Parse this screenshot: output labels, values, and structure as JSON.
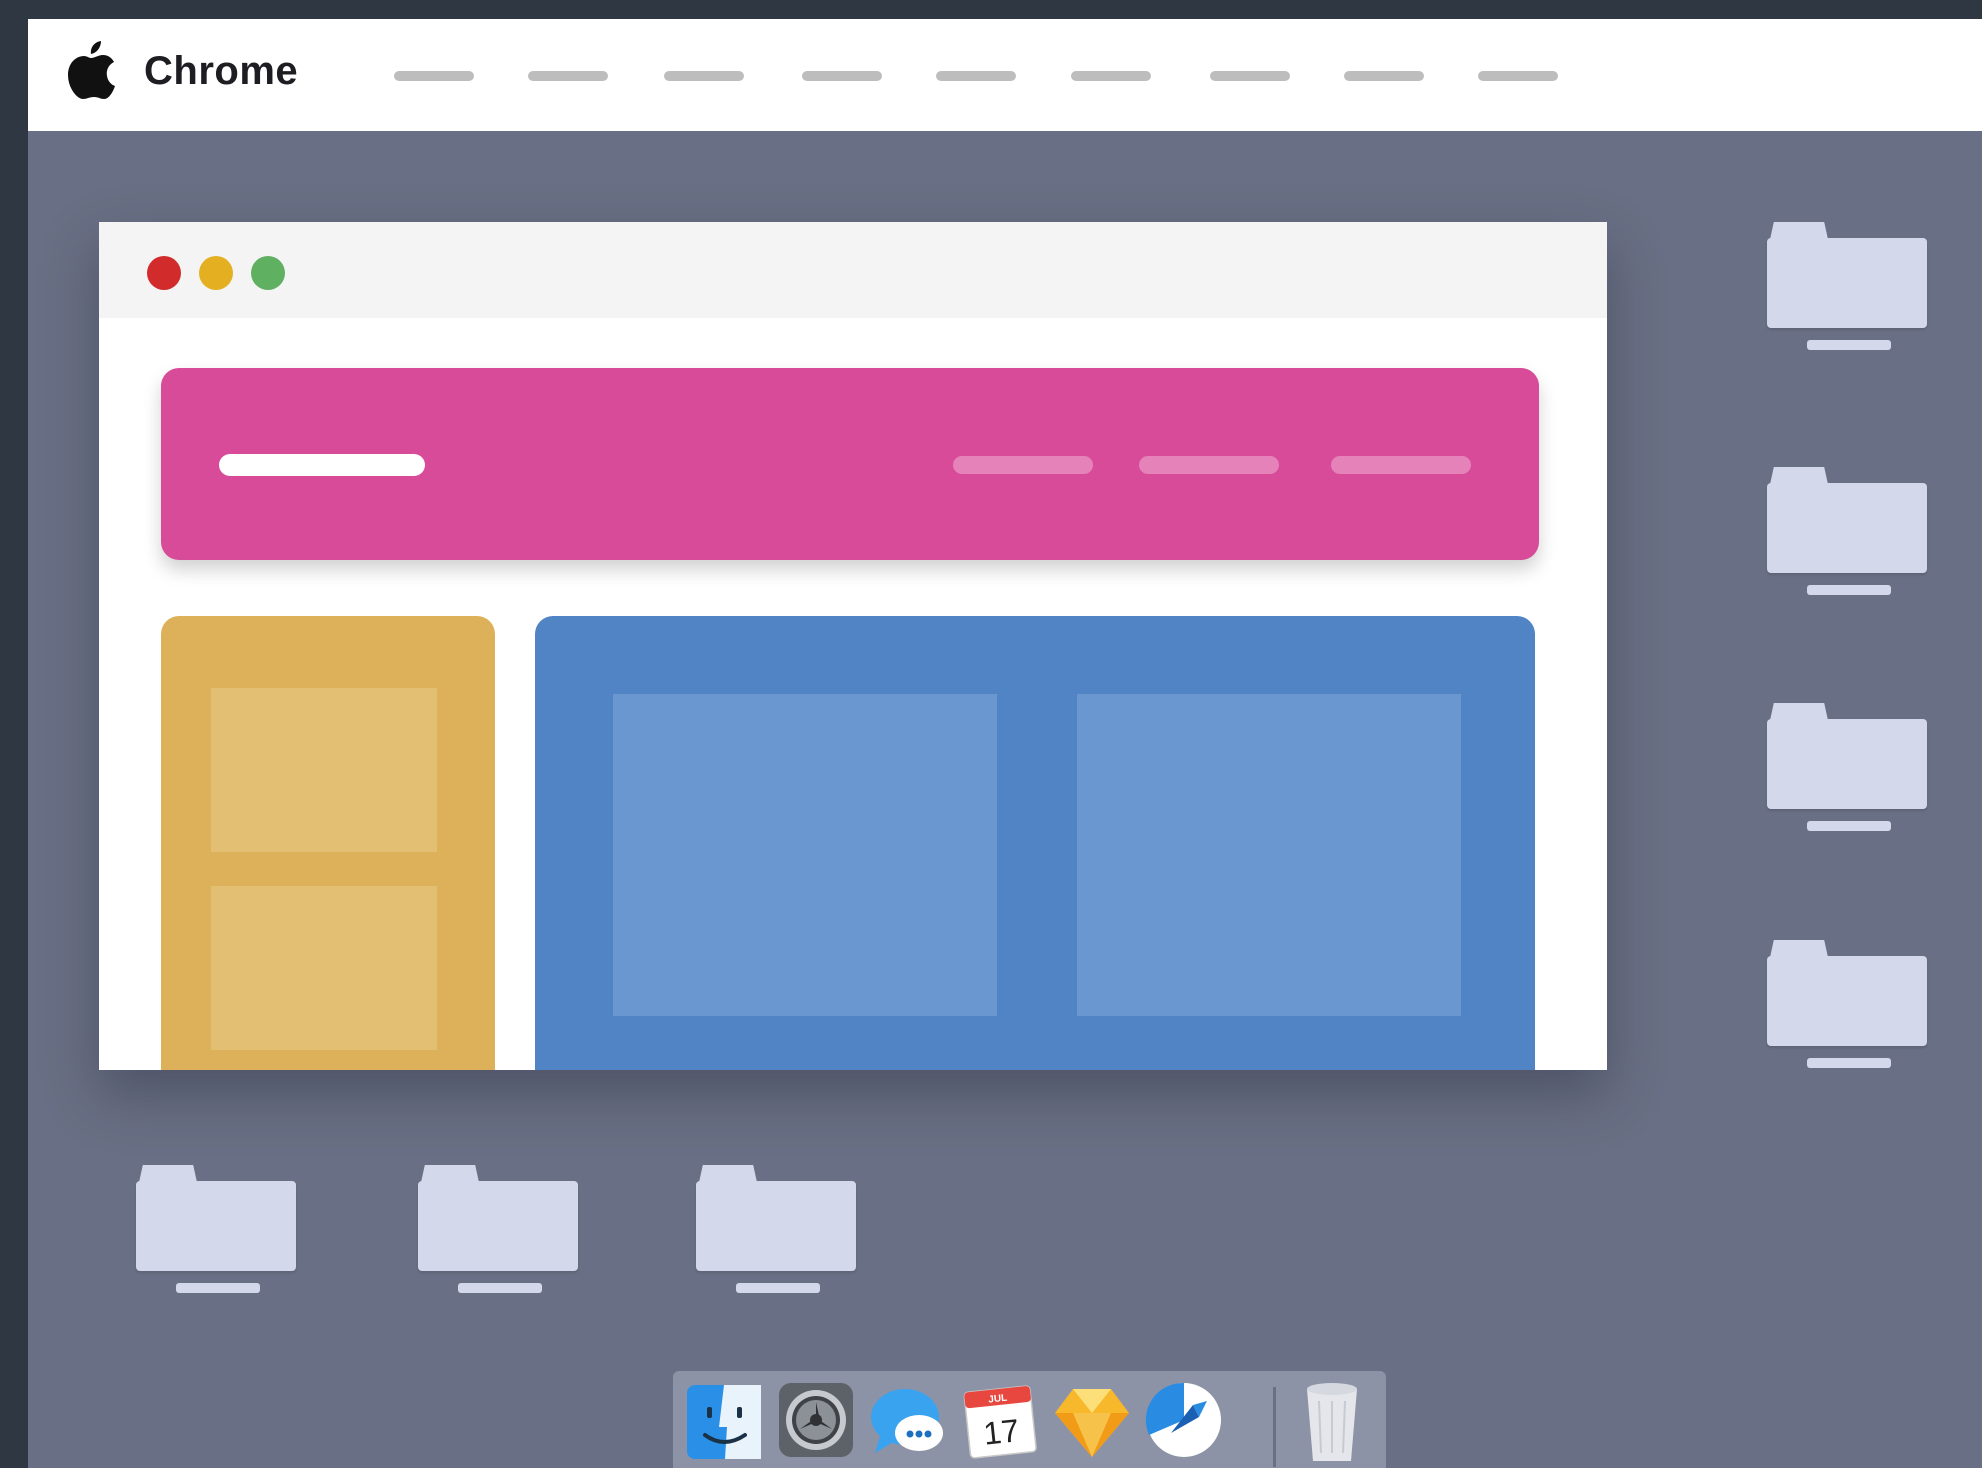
{
  "menubar": {
    "app_name": "Chrome",
    "menu_items": [
      "",
      "",
      "",
      "",
      "",
      "",
      "",
      "",
      ""
    ]
  },
  "icons": {
    "apple": "apple-logo-icon",
    "folder": "folder-icon",
    "dock": [
      "finder-icon",
      "system-preferences-icon",
      "messages-icon",
      "calendar-icon",
      "sketch-icon",
      "migration-icon",
      "trash-icon"
    ]
  },
  "dock": {
    "calendar_month": "JUL",
    "calendar_day": "17"
  },
  "colors": {
    "desktop": "#696f84",
    "hero": "#d84b98",
    "side_panel": "#ddb15a",
    "main_panel": "#5084c5",
    "close": "#d12b2b",
    "minimize": "#e4b021",
    "maximize": "#5fb061"
  }
}
